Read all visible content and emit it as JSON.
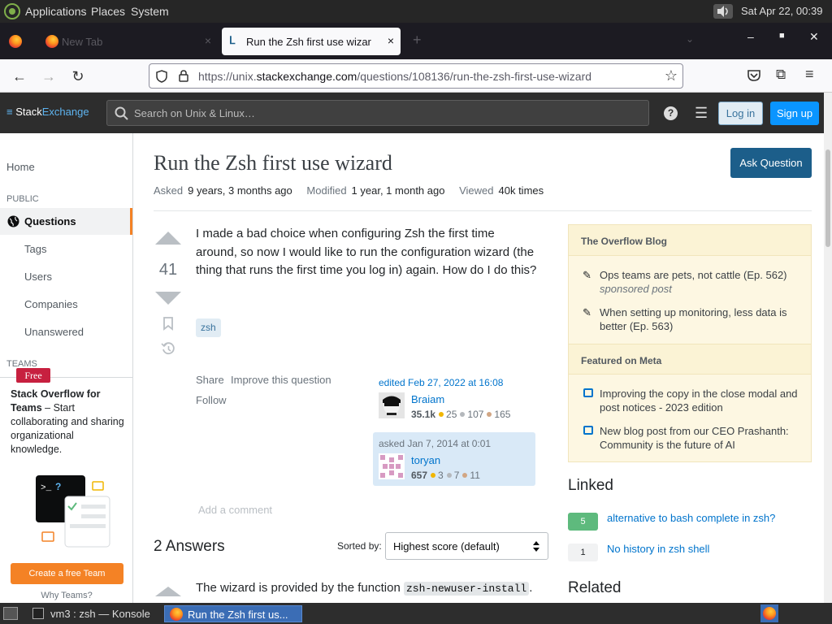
{
  "top_panel": {
    "menus": [
      "Applications",
      "Places",
      "System"
    ],
    "clock": "Sat Apr 22, 00:39"
  },
  "browser": {
    "tabs": [
      {
        "label": "New Tab"
      },
      {
        "label": "Run the Zsh first use wizar"
      }
    ],
    "tab_close": "×",
    "url_prefix": "https://unix.",
    "url_domain": "stackexchange.com",
    "url_path": "/questions/108136/run-the-zsh-first-use-wizard"
  },
  "se_header": {
    "logo_stack": "Stack",
    "logo_exchange": "Exchange",
    "search_placeholder": "Search on Unix & Linux…",
    "login": "Log in",
    "signup": "Sign up"
  },
  "sidebar": {
    "home": "Home",
    "public_heading": "PUBLIC",
    "questions": "Questions",
    "items": [
      "Tags",
      "Users",
      "Companies",
      "Unanswered"
    ],
    "teams_heading": "TEAMS",
    "teams_title": "Stack Overflow for Teams",
    "teams_desc": " – Start collaborating and sharing organizational knowledge.",
    "free_badge": "Free",
    "create_team": "Create a free Team",
    "why_teams": "Why Teams?"
  },
  "question": {
    "title": "Run the Zsh first use wizard",
    "ask_button": "Ask Question",
    "asked_label": "Asked",
    "asked_value": "9 years, 3 months ago",
    "modified_label": "Modified",
    "modified_value": "1 year, 1 month ago",
    "viewed_label": "Viewed",
    "viewed_value": "40k times",
    "votes": "41",
    "body": "I made a bad choice when configuring Zsh the first time around, so now I would like to run the configuration wizard (the thing that runs the first time you log in) again. How do I do this?",
    "tag": "zsh",
    "share": "Share",
    "improve": "Improve this question",
    "follow": "Follow",
    "editor": {
      "time": "edited Feb 27, 2022 at 16:08",
      "name": "Braiam",
      "rep": "35.1k",
      "gold": "25",
      "silver": "107",
      "bronze": "165"
    },
    "asker": {
      "time": "asked Jan 7, 2014 at 0:01",
      "name": "toryan",
      "rep": "657",
      "gold": "3",
      "silver": "7",
      "bronze": "11"
    },
    "add_comment": "Add a comment"
  },
  "answers": {
    "title": "2 Answers",
    "sorted_label": "Sorted by:",
    "sort_value": "Highest score (default)",
    "first_answer_text": "The wizard is provided by the function ",
    "first_answer_code": "zsh-newuser-install",
    "first_answer_end": "."
  },
  "right_sidebar": {
    "blog_heading": "The Overflow Blog",
    "blog_items": [
      {
        "text": "Ops teams are pets, not cattle (Ep. 562)",
        "note": "sponsored post"
      },
      {
        "text": "When setting up monitoring, less data is better (Ep. 563)",
        "note": ""
      }
    ],
    "meta_heading": "Featured on Meta",
    "meta_items": [
      "Improving the copy in the close modal and post notices - 2023 edition",
      "New blog post from our CEO Prashanth: Community is the future of AI"
    ],
    "linked_title": "Linked",
    "linked": [
      {
        "score": "5",
        "text": "alternative to bash complete in zsh?"
      },
      {
        "score": "1",
        "text": "No history in zsh shell"
      }
    ],
    "related_title": "Related"
  },
  "taskbar": {
    "konsole": "vm3 : zsh — Konsole",
    "firefox": "Run the Zsh first us..."
  },
  "colors": {
    "accent_orange": "#f48225",
    "link_blue": "#0074cc",
    "ask_button": "#1c5e8a",
    "linked_answered": "#5eba7d"
  }
}
